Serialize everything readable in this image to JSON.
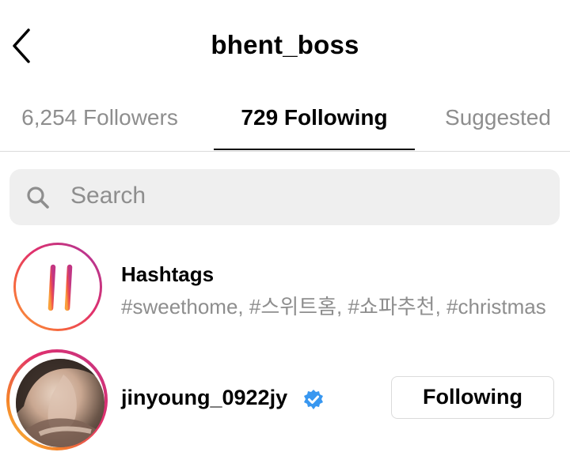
{
  "header": {
    "title": "bhent_boss"
  },
  "tabs": [
    {
      "label": "6,254 Followers",
      "active": false
    },
    {
      "label": "729 Following",
      "active": true
    },
    {
      "label": "Suggested",
      "active": false
    }
  ],
  "search": {
    "placeholder": "Search"
  },
  "list": {
    "hashtags": {
      "title": "Hashtags",
      "subtitle": "#sweethome, #스위트홈, #쇼파추천, #christmas"
    },
    "users": [
      {
        "username": "jinyoung_0922jy",
        "verified": true,
        "button_label": "Following"
      }
    ]
  },
  "colors": {
    "accent_blue": "#3897f0",
    "muted_text": "#8e8e8e",
    "divider": "#dbdbdb",
    "search_bg": "#efefef"
  },
  "icons": {
    "back": "chevron-left-icon",
    "search": "search-icon",
    "hashtag": "hashtag-icon",
    "verified": "verified-badge-icon"
  }
}
